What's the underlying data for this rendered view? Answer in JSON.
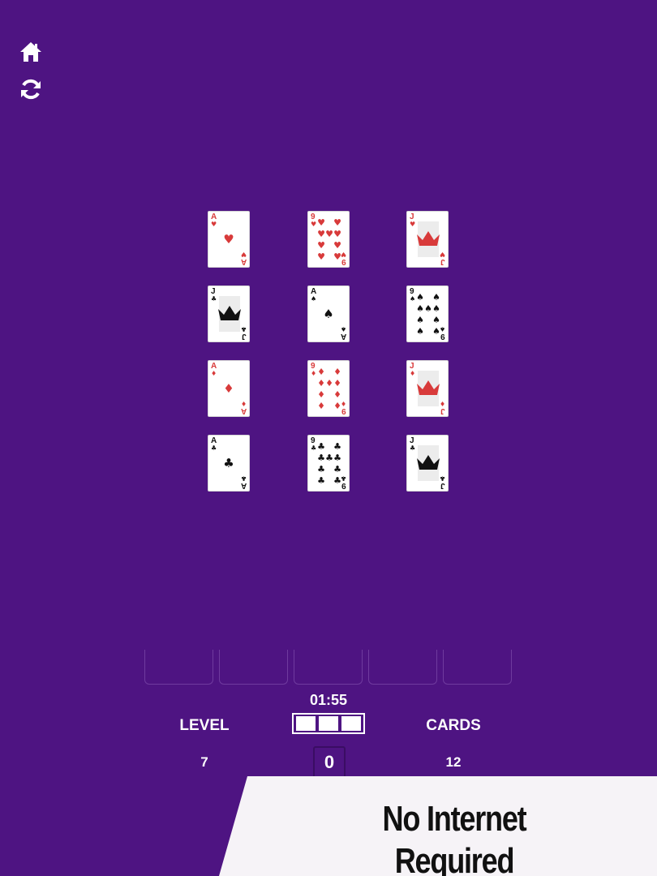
{
  "toolbar": {
    "home_icon": "home-icon",
    "restart_icon": "restart-icon"
  },
  "colors": {
    "background": "#4e1482",
    "card_red": "#d83a3a",
    "card_black": "#111111",
    "banner": "#f6f3f7"
  },
  "board": {
    "cards": [
      {
        "rank": "A",
        "suit": "♥",
        "color": "red"
      },
      {
        "rank": "9",
        "suit": "♥",
        "color": "red"
      },
      {
        "rank": "J",
        "suit": "♥",
        "color": "red"
      },
      {
        "rank": "J",
        "suit": "♣",
        "color": "black"
      },
      {
        "rank": "A",
        "suit": "♠",
        "color": "black"
      },
      {
        "rank": "9",
        "suit": "♠",
        "color": "black"
      },
      {
        "rank": "A",
        "suit": "♦",
        "color": "red"
      },
      {
        "rank": "9",
        "suit": "♦",
        "color": "red"
      },
      {
        "rank": "J",
        "suit": "♦",
        "color": "red"
      },
      {
        "rank": "A",
        "suit": "♣",
        "color": "black"
      },
      {
        "rank": "9",
        "suit": "♣",
        "color": "black"
      },
      {
        "rank": "J",
        "suit": "♣",
        "color": "black"
      }
    ]
  },
  "tray": {
    "slots": 5
  },
  "hud": {
    "timer": "01:55",
    "lives_total": 3,
    "lives_remaining": 3,
    "level_label": "LEVEL",
    "level_value": "7",
    "score_value": "0",
    "cards_label": "CARDS",
    "cards_value": "12"
  },
  "banner": {
    "text": "No Internet Required"
  }
}
